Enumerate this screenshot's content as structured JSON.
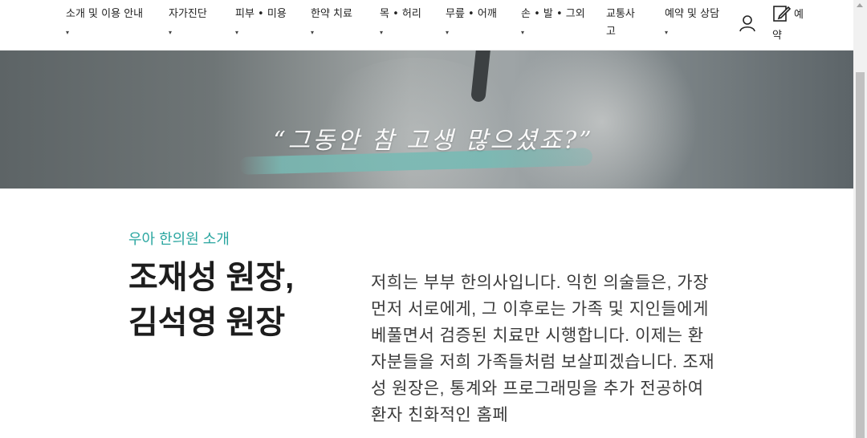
{
  "nav": {
    "items": [
      {
        "label": "소개 및 이용 안내",
        "caret": "▾"
      },
      {
        "label": "자가진단",
        "caret": "▾"
      },
      {
        "label": "피부 • 미용",
        "caret": "▾"
      },
      {
        "label": "한약 치료",
        "caret": "▾"
      },
      {
        "label": "목 • 허리",
        "caret": "▾"
      },
      {
        "label": "무릎 • 어깨",
        "caret": "▾"
      },
      {
        "label": "손 • 발 • 그외",
        "caret": "▾"
      },
      {
        "label": "교통사고",
        "caret": ""
      },
      {
        "label": "예약 및 상담",
        "caret": "▾"
      }
    ],
    "user_icon": "user-icon",
    "reserve": {
      "line1": "예",
      "line2": "약",
      "icon": "edit-icon"
    }
  },
  "banner": {
    "quote": "“그동안 참 고생 많으셨죠?”"
  },
  "intro": {
    "label": "우아 한의원 소개",
    "title_line1": "조재성 원장,",
    "title_line2": "김석영 원장",
    "body": "저희는 부부 한의사입니다. 익힌 의술들은, 가장 먼저 서로에게, 그 이후로는 가족 및 지인들에게 베풀면서 검증된 치료만 시행합니다. 이제는 환자분들을 저희 가족들처럼 보살피겠습니다. 조재성 원장은, 통계와 프로그래밍을 추가 전공하여 환자 친화적인 홈페"
  },
  "colors": {
    "accent": "#2aa6a0",
    "brush": "#78bab4"
  }
}
